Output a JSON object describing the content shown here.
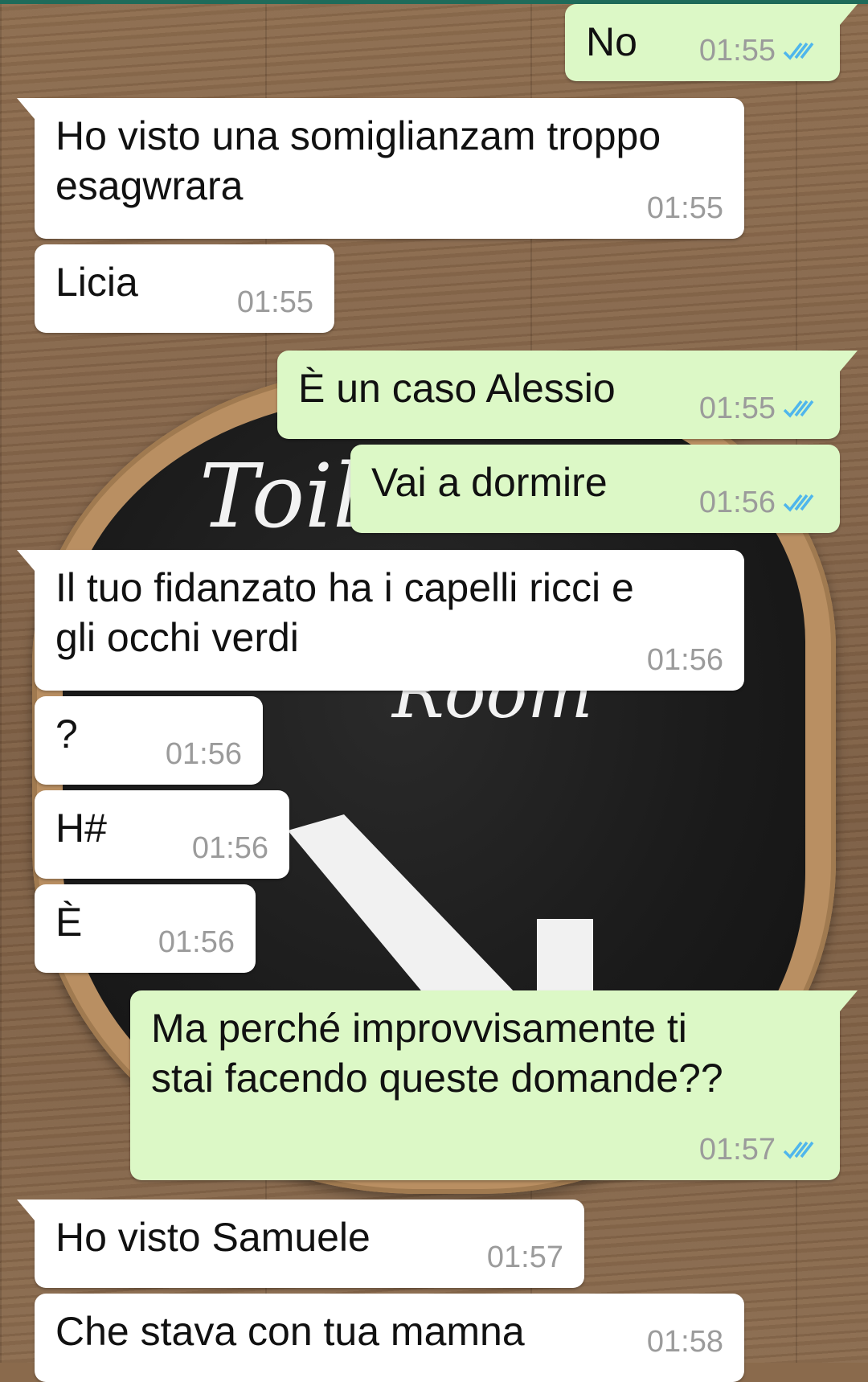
{
  "theme": {
    "incoming_bubble": "#ffffff",
    "outgoing_bubble": "#dcf8c6",
    "timestamp_color": "#9b9b9b",
    "read_receipt_color": "#4fb6ec"
  },
  "messages": [
    {
      "direction": "out",
      "text": "No",
      "time": "01:55",
      "status": "read"
    },
    {
      "direction": "in",
      "text": "Ho visto una somiglianzam troppo\nesagwrara",
      "time": "01:55"
    },
    {
      "direction": "in",
      "text": "Licia",
      "time": "01:55"
    },
    {
      "direction": "out",
      "text": "È un caso Alessio",
      "time": "01:55",
      "status": "read"
    },
    {
      "direction": "out",
      "text": "Vai a dormire",
      "time": "01:56",
      "status": "read"
    },
    {
      "direction": "in",
      "text": "Il tuo fidanzato ha i capelli ricci e\ngli occhi verdi",
      "time": "01:56"
    },
    {
      "direction": "in",
      "text": "?",
      "time": "01:56"
    },
    {
      "direction": "in",
      "text": "H#",
      "time": "01:56"
    },
    {
      "direction": "in",
      "text": "È",
      "time": "01:56"
    },
    {
      "direction": "out",
      "text": "Ma perché improvvisamente ti\nstai facendo queste domande??",
      "time": "01:57",
      "status": "read"
    },
    {
      "direction": "in",
      "text": "Ho visto Samuele",
      "time": "01:57"
    },
    {
      "direction": "in",
      "text": "Che stava con tua mamna",
      "time": "01:58"
    }
  ],
  "wallpaper": {
    "description_icon": "chalkboard-sign-image",
    "sign_title": "Toil",
    "sign_subtitle": "Room"
  }
}
